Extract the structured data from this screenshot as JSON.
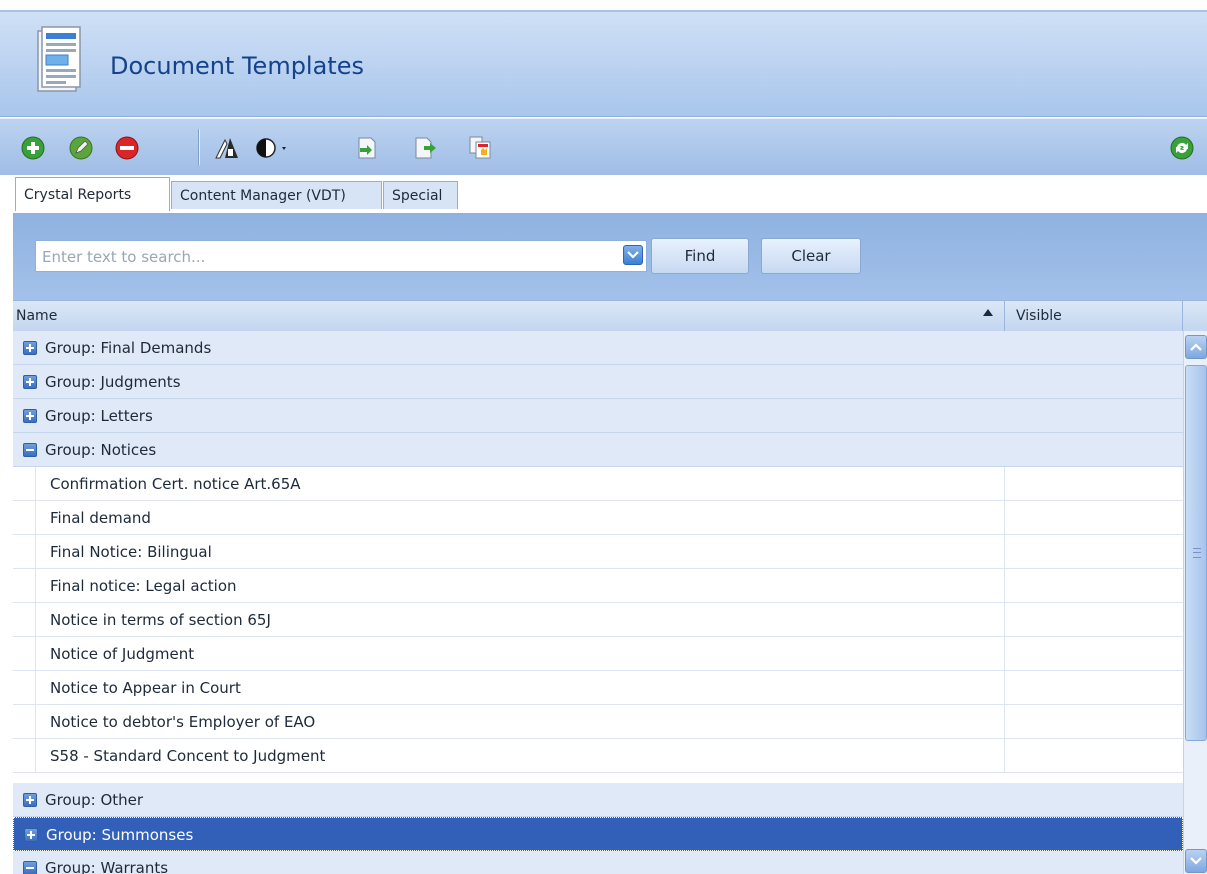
{
  "header": {
    "title": "Document Templates",
    "icon": "document-templates-icon"
  },
  "toolbar": {
    "buttons": [
      {
        "name": "add-icon",
        "color": "#3aa13a"
      },
      {
        "name": "edit-icon",
        "color": "#5aa63c"
      },
      {
        "name": "delete-icon",
        "color": "#d8262b"
      },
      {
        "name": "designer-icon"
      },
      {
        "name": "contrast-icon"
      },
      {
        "name": "import-icon"
      },
      {
        "name": "export-icon"
      },
      {
        "name": "preview-icon"
      },
      {
        "name": "refresh-icon",
        "color": "#3aa13a"
      }
    ]
  },
  "tabs": [
    {
      "label": "Crystal Reports",
      "active": true
    },
    {
      "label": "Content Manager (VDT)",
      "active": false
    },
    {
      "label": "Special",
      "active": false
    }
  ],
  "search": {
    "placeholder": "Enter text to search...",
    "value": "",
    "find_label": "Find",
    "clear_label": "Clear"
  },
  "grid": {
    "columns": {
      "name": "Name",
      "visible": "Visible"
    },
    "rows": [
      {
        "type": "group",
        "label": "Group: Final Demands",
        "expanded": false
      },
      {
        "type": "group",
        "label": "Group: Judgments",
        "expanded": false
      },
      {
        "type": "group",
        "label": "Group: Letters",
        "expanded": false
      },
      {
        "type": "group",
        "label": "Group: Notices",
        "expanded": true
      },
      {
        "type": "item",
        "label": "Confirmation Cert. notice Art.65A"
      },
      {
        "type": "item",
        "label": "Final demand"
      },
      {
        "type": "item",
        "label": "Final Notice: Bilingual"
      },
      {
        "type": "item",
        "label": "Final notice: Legal action"
      },
      {
        "type": "item",
        "label": "Notice in terms of section 65J"
      },
      {
        "type": "item",
        "label": "Notice of Judgment"
      },
      {
        "type": "item",
        "label": "Notice to Appear in Court"
      },
      {
        "type": "item",
        "label": "Notice to debtor's Employer of EAO"
      },
      {
        "type": "item",
        "label": "S58 - Standard Concent to Judgment"
      },
      {
        "type": "group",
        "label": "Group: Other",
        "expanded": false
      },
      {
        "type": "group",
        "label": "Group: Summonses",
        "expanded": false,
        "selected": true
      },
      {
        "type": "group",
        "label": "Group: Warrants",
        "expanded": true
      }
    ]
  },
  "colors": {
    "accent": "#15428b",
    "selection": "#3260b8",
    "header_blue": "#a9c6ec"
  }
}
